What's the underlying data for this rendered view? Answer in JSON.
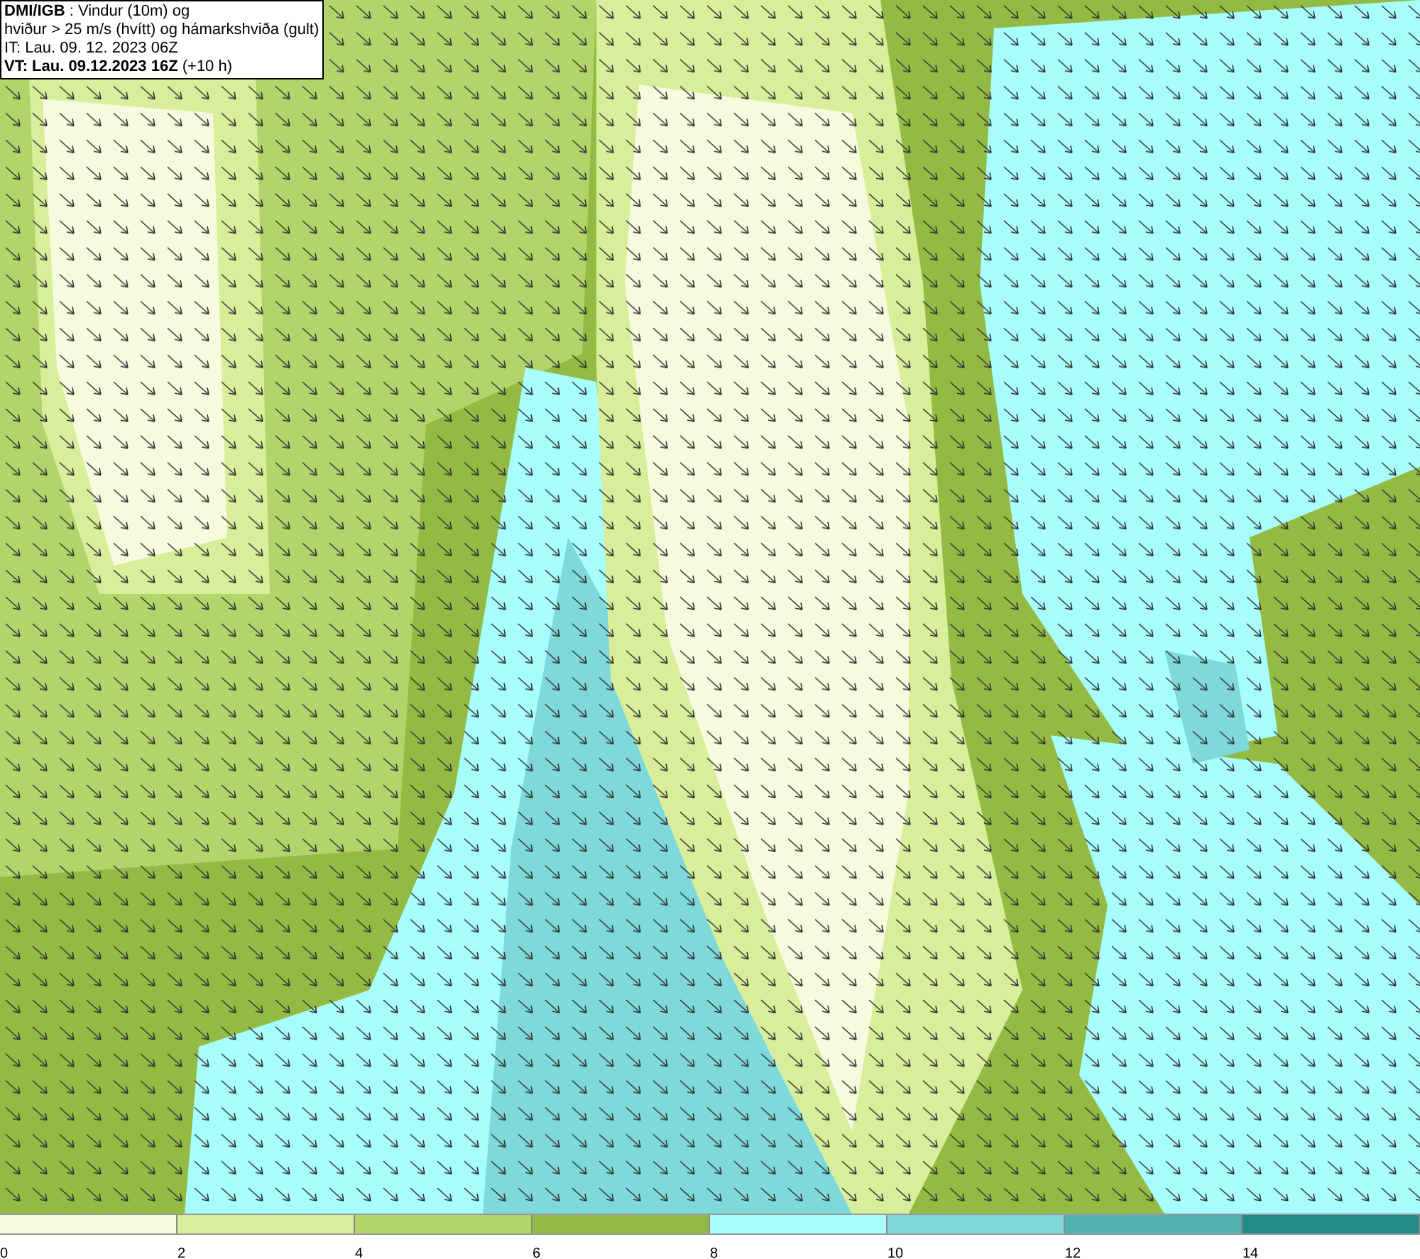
{
  "info_box": {
    "lines": [
      "**DMI/IGB** : Vindur (10m) og",
      "hviður > 25 m/s (hvítt) og hámarkshviða (gult)",
      "IT: Lau. 09. 12. 2023 06Z",
      "**VT: Lau. 09.12.2023 16Z** (+10 h)"
    ]
  },
  "legend": {
    "bins": [
      {
        "color": "#f7fadc",
        "label": "0"
      },
      {
        "color": "#d8ee9a",
        "label": "2"
      },
      {
        "color": "#b3d46a",
        "label": "4"
      },
      {
        "color": "#93bb44",
        "label": "6"
      },
      {
        "color": "#a8fdfd",
        "label": "8"
      },
      {
        "color": "#7fd9da",
        "label": "10"
      },
      {
        "color": "#52b2b2",
        "label": "12"
      },
      {
        "color": "#238c8a",
        "label": "14"
      }
    ]
  }
}
